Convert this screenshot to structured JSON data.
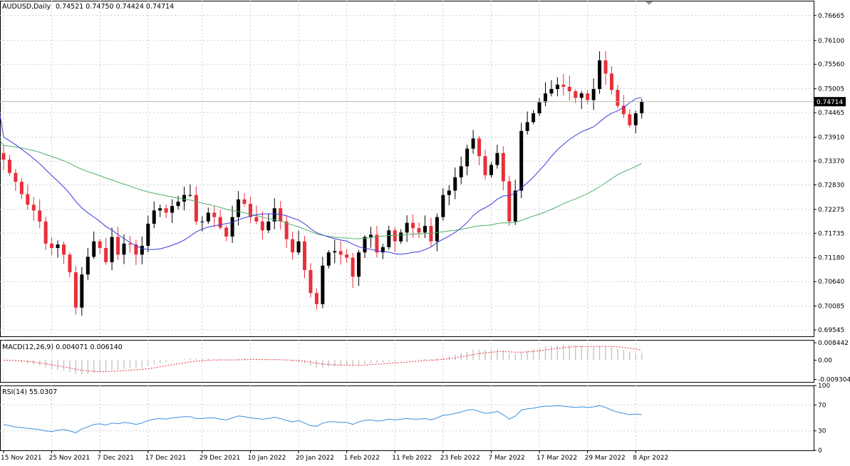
{
  "header": {
    "symbol": "AUDUSD,Daily",
    "ohlc": "0.74521 0.74750 0.74424 0.74714"
  },
  "colors": {
    "bull": "#000000",
    "bear": "#e8303a",
    "ma_fast": "#3a3ad8",
    "ma_slow": "#4fb06a",
    "macd_hist": "#c8c8c8",
    "macd_signal": "#e8303a",
    "rsi": "#3c8fe0",
    "grid": "#c8d0d8"
  },
  "chart_data": [
    {
      "type": "candlestick",
      "name": "price",
      "ylim": [
        0.694,
        0.77
      ],
      "y_ticks": [
        "0.76665",
        "0.76100",
        "0.75560",
        "0.75005",
        "0.74465",
        "0.73910",
        "0.73370",
        "0.72830",
        "0.72275",
        "0.71735",
        "0.71180",
        "0.70640",
        "0.70085",
        "0.69545"
      ],
      "last_price_label": "0.74714",
      "x_tick_labels": [
        "15 Nov 2021",
        "25 Nov 2021",
        "7 Dec 2021",
        "17 Dec 2021",
        "29 Dec 2021",
        "10 Jan 2022",
        "20 Jan 2022",
        "1 Feb 2022",
        "11 Feb 2022",
        "23 Feb 2022",
        "7 Mar 2022",
        "17 Mar 2022",
        "29 Mar 2022",
        "8 Apr 2022"
      ],
      "closes": [
        0.734,
        0.731,
        0.729,
        0.7262,
        0.7238,
        0.7225,
        0.72,
        0.715,
        0.714,
        0.7148,
        0.7125,
        0.7085,
        0.7005,
        0.708,
        0.712,
        0.7155,
        0.714,
        0.7108,
        0.7165,
        0.7125,
        0.715,
        0.7148,
        0.7125,
        0.7145,
        0.7195,
        0.7225,
        0.723,
        0.722,
        0.7235,
        0.7245,
        0.726,
        0.726,
        0.72,
        0.72,
        0.722,
        0.721,
        0.7186,
        0.7166,
        0.721,
        0.725,
        0.724,
        0.721,
        0.72,
        0.718,
        0.72,
        0.723,
        0.72,
        0.716,
        0.713,
        0.7155,
        0.709,
        0.7038,
        0.7013,
        0.71,
        0.713,
        0.7133,
        0.7125,
        0.7118,
        0.7075,
        0.713,
        0.7165,
        0.717,
        0.713,
        0.7142,
        0.718,
        0.7155,
        0.7175,
        0.7197,
        0.7185,
        0.7175,
        0.719,
        0.7155,
        0.721,
        0.726,
        0.727,
        0.73,
        0.7325,
        0.7365,
        0.7388,
        0.7348,
        0.7305,
        0.7328,
        0.7355,
        0.7291,
        0.72,
        0.727,
        0.7405,
        0.7425,
        0.7445,
        0.747,
        0.749,
        0.75,
        0.751,
        0.7505,
        0.7495,
        0.748,
        0.749,
        0.7475,
        0.75,
        0.7565,
        0.7535,
        0.7498,
        0.7462,
        0.7443,
        0.7418,
        0.7445,
        0.7471
      ],
      "series": [
        {
          "name": "MA fast",
          "period": 20
        },
        {
          "name": "MA slow",
          "period": 50
        }
      ]
    },
    {
      "type": "macd",
      "label": "MACD(12,26,9) 0.004071 0.006140",
      "ylim": [
        -0.0105,
        0.0098
      ],
      "y_ticks": [
        "0.008442",
        "0.00",
        "-0.009304"
      ]
    },
    {
      "type": "line",
      "label": "RSI(14) 55.0307",
      "ylim": [
        0,
        100
      ],
      "y_ticks": [
        "100",
        "70",
        "30",
        "0"
      ],
      "values": [
        40,
        38,
        36,
        35,
        34,
        33,
        32,
        30,
        29,
        31,
        32,
        30,
        27,
        33,
        36,
        40,
        41,
        39,
        42,
        41,
        43,
        42,
        40,
        42,
        46,
        48,
        49,
        48,
        50,
        51,
        52,
        52,
        49,
        49,
        50,
        50,
        48,
        47,
        50,
        53,
        52,
        50,
        49,
        48,
        49,
        51,
        49,
        46,
        44,
        46,
        42,
        38,
        37,
        42,
        44,
        44,
        43,
        43,
        40,
        44,
        46,
        47,
        45,
        46,
        48,
        47,
        48,
        49,
        48,
        48,
        49,
        47,
        50,
        54,
        55,
        57,
        59,
        62,
        63,
        60,
        57,
        58,
        60,
        55,
        48,
        53,
        62,
        64,
        65,
        67,
        68,
        68,
        69,
        68,
        67,
        66,
        67,
        66,
        67,
        69,
        66,
        62,
        59,
        57,
        55,
        56,
        55
      ]
    }
  ]
}
